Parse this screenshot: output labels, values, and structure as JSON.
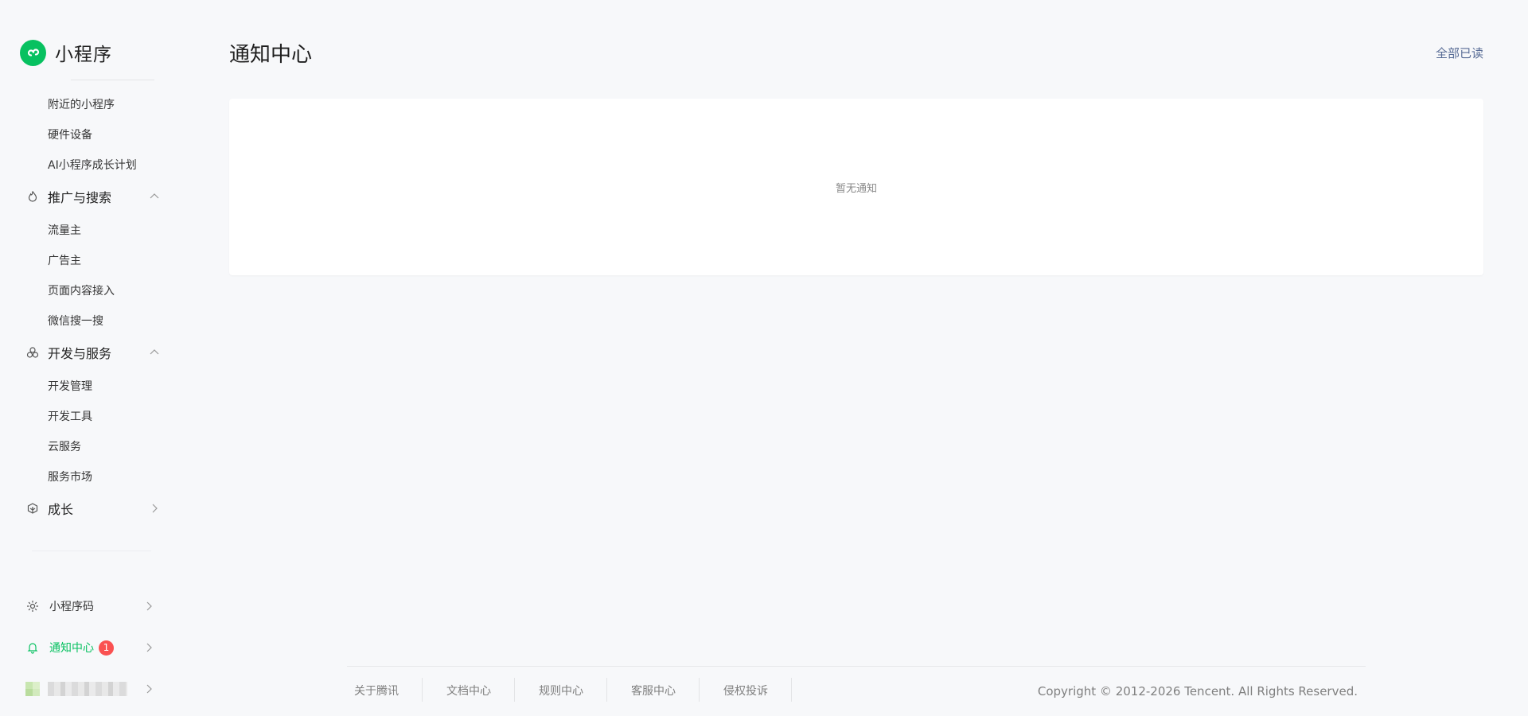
{
  "brand": {
    "name": "小程序"
  },
  "sidebar": {
    "top_items": [
      "附近的小程序",
      "硬件设备",
      "AI小程序成长计划"
    ],
    "groups": [
      {
        "label": "推广与搜索",
        "icon": "flame-icon",
        "expanded": true,
        "items": [
          "流量主",
          "广告主",
          "页面内容接入",
          "微信搜一搜"
        ]
      },
      {
        "label": "开发与服务",
        "icon": "circles-icon",
        "expanded": true,
        "items": [
          "开发管理",
          "开发工具",
          "云服务",
          "服务市场"
        ]
      },
      {
        "label": "成长",
        "icon": "growth-icon",
        "expanded": false,
        "items": []
      }
    ],
    "bottom": {
      "qrcode_label": "小程序码",
      "notify_label": "通知中心",
      "notify_count": "1"
    }
  },
  "main": {
    "title": "通知中心",
    "mark_all_read": "全部已读",
    "empty_text": "暂无通知"
  },
  "footer": {
    "links": [
      "关于腾讯",
      "文档中心",
      "规则中心",
      "客服中心",
      "侵权投诉"
    ],
    "copyright": "Copyright © 2012-2026 Tencent. All Rights Reserved."
  },
  "colors": {
    "accent": "#07c160",
    "link": "#576b95",
    "badge": "#fa5151"
  }
}
